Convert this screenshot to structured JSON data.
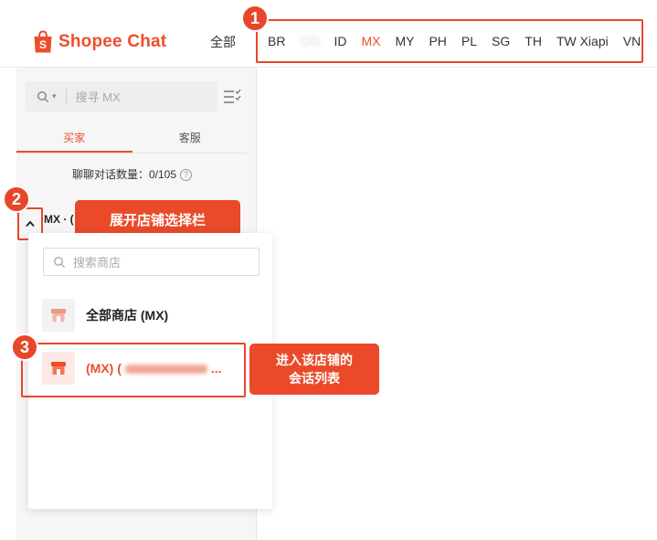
{
  "header": {
    "logo_text": "Shopee Chat",
    "all_label": "全部",
    "regions": [
      {
        "label": "BR",
        "active": false,
        "blurred": false
      },
      {
        "label": "CO",
        "active": false,
        "blurred": true
      },
      {
        "label": "ID",
        "active": false,
        "blurred": false
      },
      {
        "label": "MX",
        "active": true,
        "blurred": false
      },
      {
        "label": "MY",
        "active": false,
        "blurred": false
      },
      {
        "label": "PH",
        "active": false,
        "blurred": false
      },
      {
        "label": "PL",
        "active": false,
        "blurred": false
      },
      {
        "label": "SG",
        "active": false,
        "blurred": false
      },
      {
        "label": "TH",
        "active": false,
        "blurred": false
      },
      {
        "label": "TW Xiapi",
        "active": false,
        "blurred": false
      },
      {
        "label": "VN",
        "active": false,
        "blurred": false
      }
    ]
  },
  "sidebar": {
    "search_placeholder": "搜寻 MX",
    "tabs": [
      {
        "label": "买家",
        "active": true
      },
      {
        "label": "客服",
        "active": false
      }
    ],
    "count_label": "聊聊对话数量：0/105",
    "help_glyph": "?",
    "current_shop": "MX · (",
    "chevron_icon": "chevron-up-icon"
  },
  "dropdown": {
    "search_placeholder": "搜索商店",
    "shops": [
      {
        "name": "全部商店 (MX)",
        "accent": false
      },
      {
        "name": "(MX) (",
        "suffix": "...",
        "accent": true
      }
    ]
  },
  "annotations": {
    "markers": [
      "1",
      "2",
      "3"
    ],
    "callout_expand": "展开店铺选择栏",
    "callout_enter_line1": "进入该店铺的",
    "callout_enter_line2": "会话列表"
  },
  "colors": {
    "brand": "#ee4d2d",
    "annotation": "#e8462a"
  }
}
